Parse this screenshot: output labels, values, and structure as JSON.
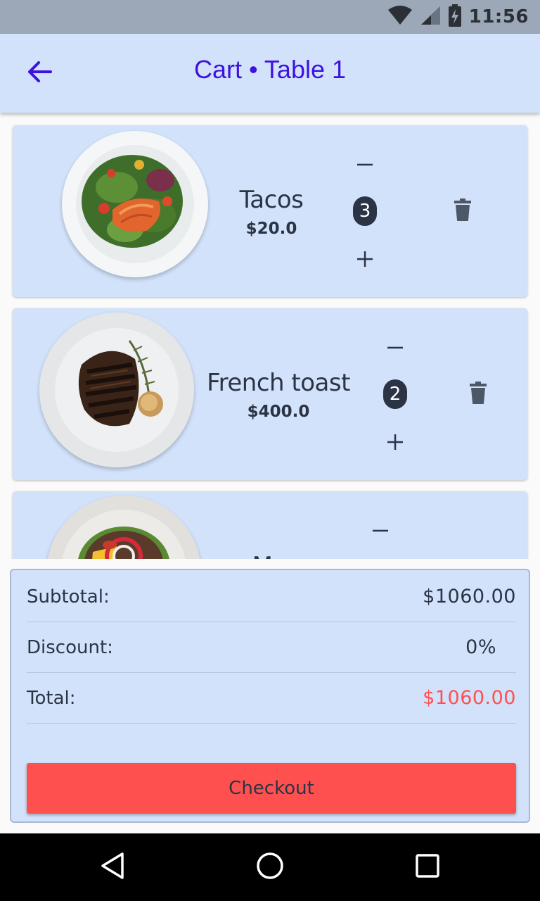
{
  "status_bar": {
    "time": "11:56",
    "icons": [
      "wifi-icon",
      "signal-icon",
      "battery-charging-icon"
    ]
  },
  "app_bar": {
    "back_icon": "arrow-left-icon",
    "title": "Cart • Table 1"
  },
  "cart": {
    "items": [
      {
        "name": "Tacos",
        "price": "$20.0",
        "quantity": "3",
        "dish": "salmon-salad"
      },
      {
        "name": "French toast",
        "price": "$400.0",
        "quantity": "2",
        "dish": "grilled-steak"
      },
      {
        "name": "M",
        "price": "",
        "quantity": "",
        "dish": "burger"
      }
    ],
    "decrease_icon": "minus-icon",
    "increase_icon": "plus-icon",
    "delete_icon": "trash-icon"
  },
  "summary": {
    "subtotal_label": "Subtotal:",
    "subtotal_value": "$1060.00",
    "discount_label": "Discount:",
    "discount_value": "0%",
    "total_label": "Total:",
    "total_value": "$1060.00",
    "checkout_label": "Checkout"
  },
  "colors": {
    "accent": "#3d12e0",
    "card_background": "#d2e2fa",
    "total_red": "#ff5050",
    "text_dark": "#2b3445"
  },
  "nav_bar": {
    "icons": [
      "back-triangle-icon",
      "home-circle-icon",
      "recents-square-icon"
    ]
  }
}
